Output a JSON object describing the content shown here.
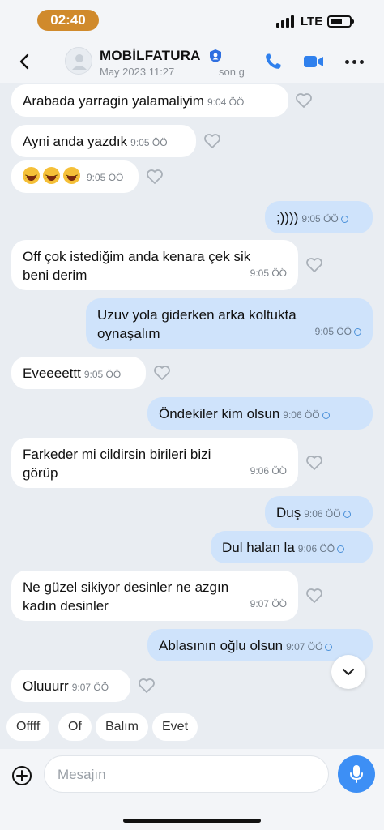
{
  "status_bar": {
    "time": "02:40",
    "network": "LTE",
    "signal_icon": "signal-bars-icon",
    "battery_icon": "battery-icon"
  },
  "header": {
    "contact_name": "MOBİLFATURA",
    "last_seen_date": "May 2023 11:27",
    "last_seen_label": "son g",
    "icons": [
      "back-chevron-icon",
      "avatar-placeholder",
      "shield-verified-icon",
      "phone-icon",
      "video-camera-icon",
      "more-dots-icon"
    ]
  },
  "messages": [
    {
      "direction": "in",
      "text": "Arabada yarragin yalamaliyim",
      "time": "9:04 ÖÖ"
    },
    {
      "direction": "in",
      "text": "Ayni anda yazdık",
      "time": "9:05 ÖÖ"
    },
    {
      "direction": "in",
      "text": "",
      "emoji": "grinning-squinting-face x3",
      "time": "9:05 ÖÖ"
    },
    {
      "direction": "out",
      "text": ";))))",
      "time": "9:05 ÖÖ"
    },
    {
      "direction": "in",
      "text_lines": [
        "Off çok istediğim anda kenara çek sik",
        "beni derim"
      ],
      "time": "9:05 ÖÖ"
    },
    {
      "direction": "out",
      "text_lines": [
        "Uzuv yola giderken arka koltukta",
        "oynaşalım"
      ],
      "time": "9:05 ÖÖ"
    },
    {
      "direction": "in",
      "text": "Eveeeettt",
      "time": "9:05 ÖÖ"
    },
    {
      "direction": "out",
      "text": "Öndekiler kim olsun",
      "time": "9:06 ÖÖ"
    },
    {
      "direction": "in",
      "text_lines": [
        "Farkeder mi cildirsin birileri bizi",
        "görüp"
      ],
      "time": "9:06 ÖÖ"
    },
    {
      "direction": "out",
      "text": "Duş",
      "time": "9:06 ÖÖ"
    },
    {
      "direction": "out",
      "text": "Dul halan la",
      "time": "9:06 ÖÖ"
    },
    {
      "direction": "in",
      "text_lines": [
        "Ne güzel sikiyor desinler ne azgın",
        "kadın desinler"
      ],
      "time": "9:07 ÖÖ"
    },
    {
      "direction": "out",
      "text": "Ablasının oğlu olsun",
      "time": "9:07 ÖÖ"
    },
    {
      "direction": "in",
      "text": "Oluuurr",
      "time": "9:07 ÖÖ"
    }
  ],
  "quick_replies": [
    "Offff",
    "Of",
    "Balım",
    "Evet"
  ],
  "composer": {
    "placeholder": "Mesajın",
    "icons": [
      "add-circle-icon",
      "smile-icon",
      "microphone-icon"
    ]
  },
  "colors": {
    "accent": "#3d8ff5",
    "outgoing_bubble": "#cfe3fb",
    "incoming_bubble": "#ffffff",
    "background": "#e9edf2",
    "time_pill": "#d08a2c"
  }
}
